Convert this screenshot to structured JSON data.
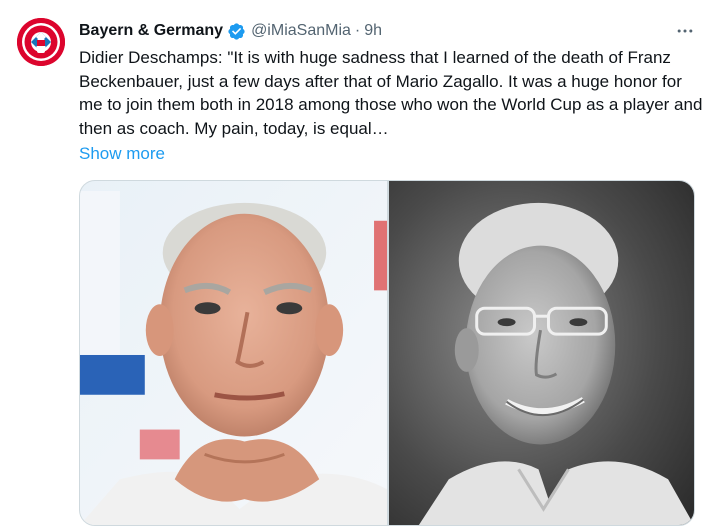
{
  "tweet": {
    "author": {
      "display_name": "Bayern & Germany",
      "handle": "@iMiaSanMia",
      "separator": "·",
      "time": "9h",
      "verified": true,
      "avatar_icon": "fc-bayern-crest-avatar"
    },
    "text": "Didier Deschamps: \"It is with huge sadness that I learned of the death of Franz Beckenbauer, just a few days after that of Mario Zagallo. It was a huge honor for me to join them both in 2018 among those who won the World Cup as a player and then as coach. My pain, today, is equal…",
    "show_more_label": "Show more",
    "more_icon": "more-dots-icon",
    "media": [
      {
        "kind": "photo",
        "subject": "deschamps-photo"
      },
      {
        "kind": "photo",
        "subject": "beckenbauer-photo"
      }
    ]
  },
  "colors": {
    "text_primary": "#0f1419",
    "text_secondary": "#536471",
    "link": "#1d9bf0",
    "verified": "#1d9bf0",
    "border": "#cfd9de",
    "avatar_bg": "#dc052d"
  }
}
